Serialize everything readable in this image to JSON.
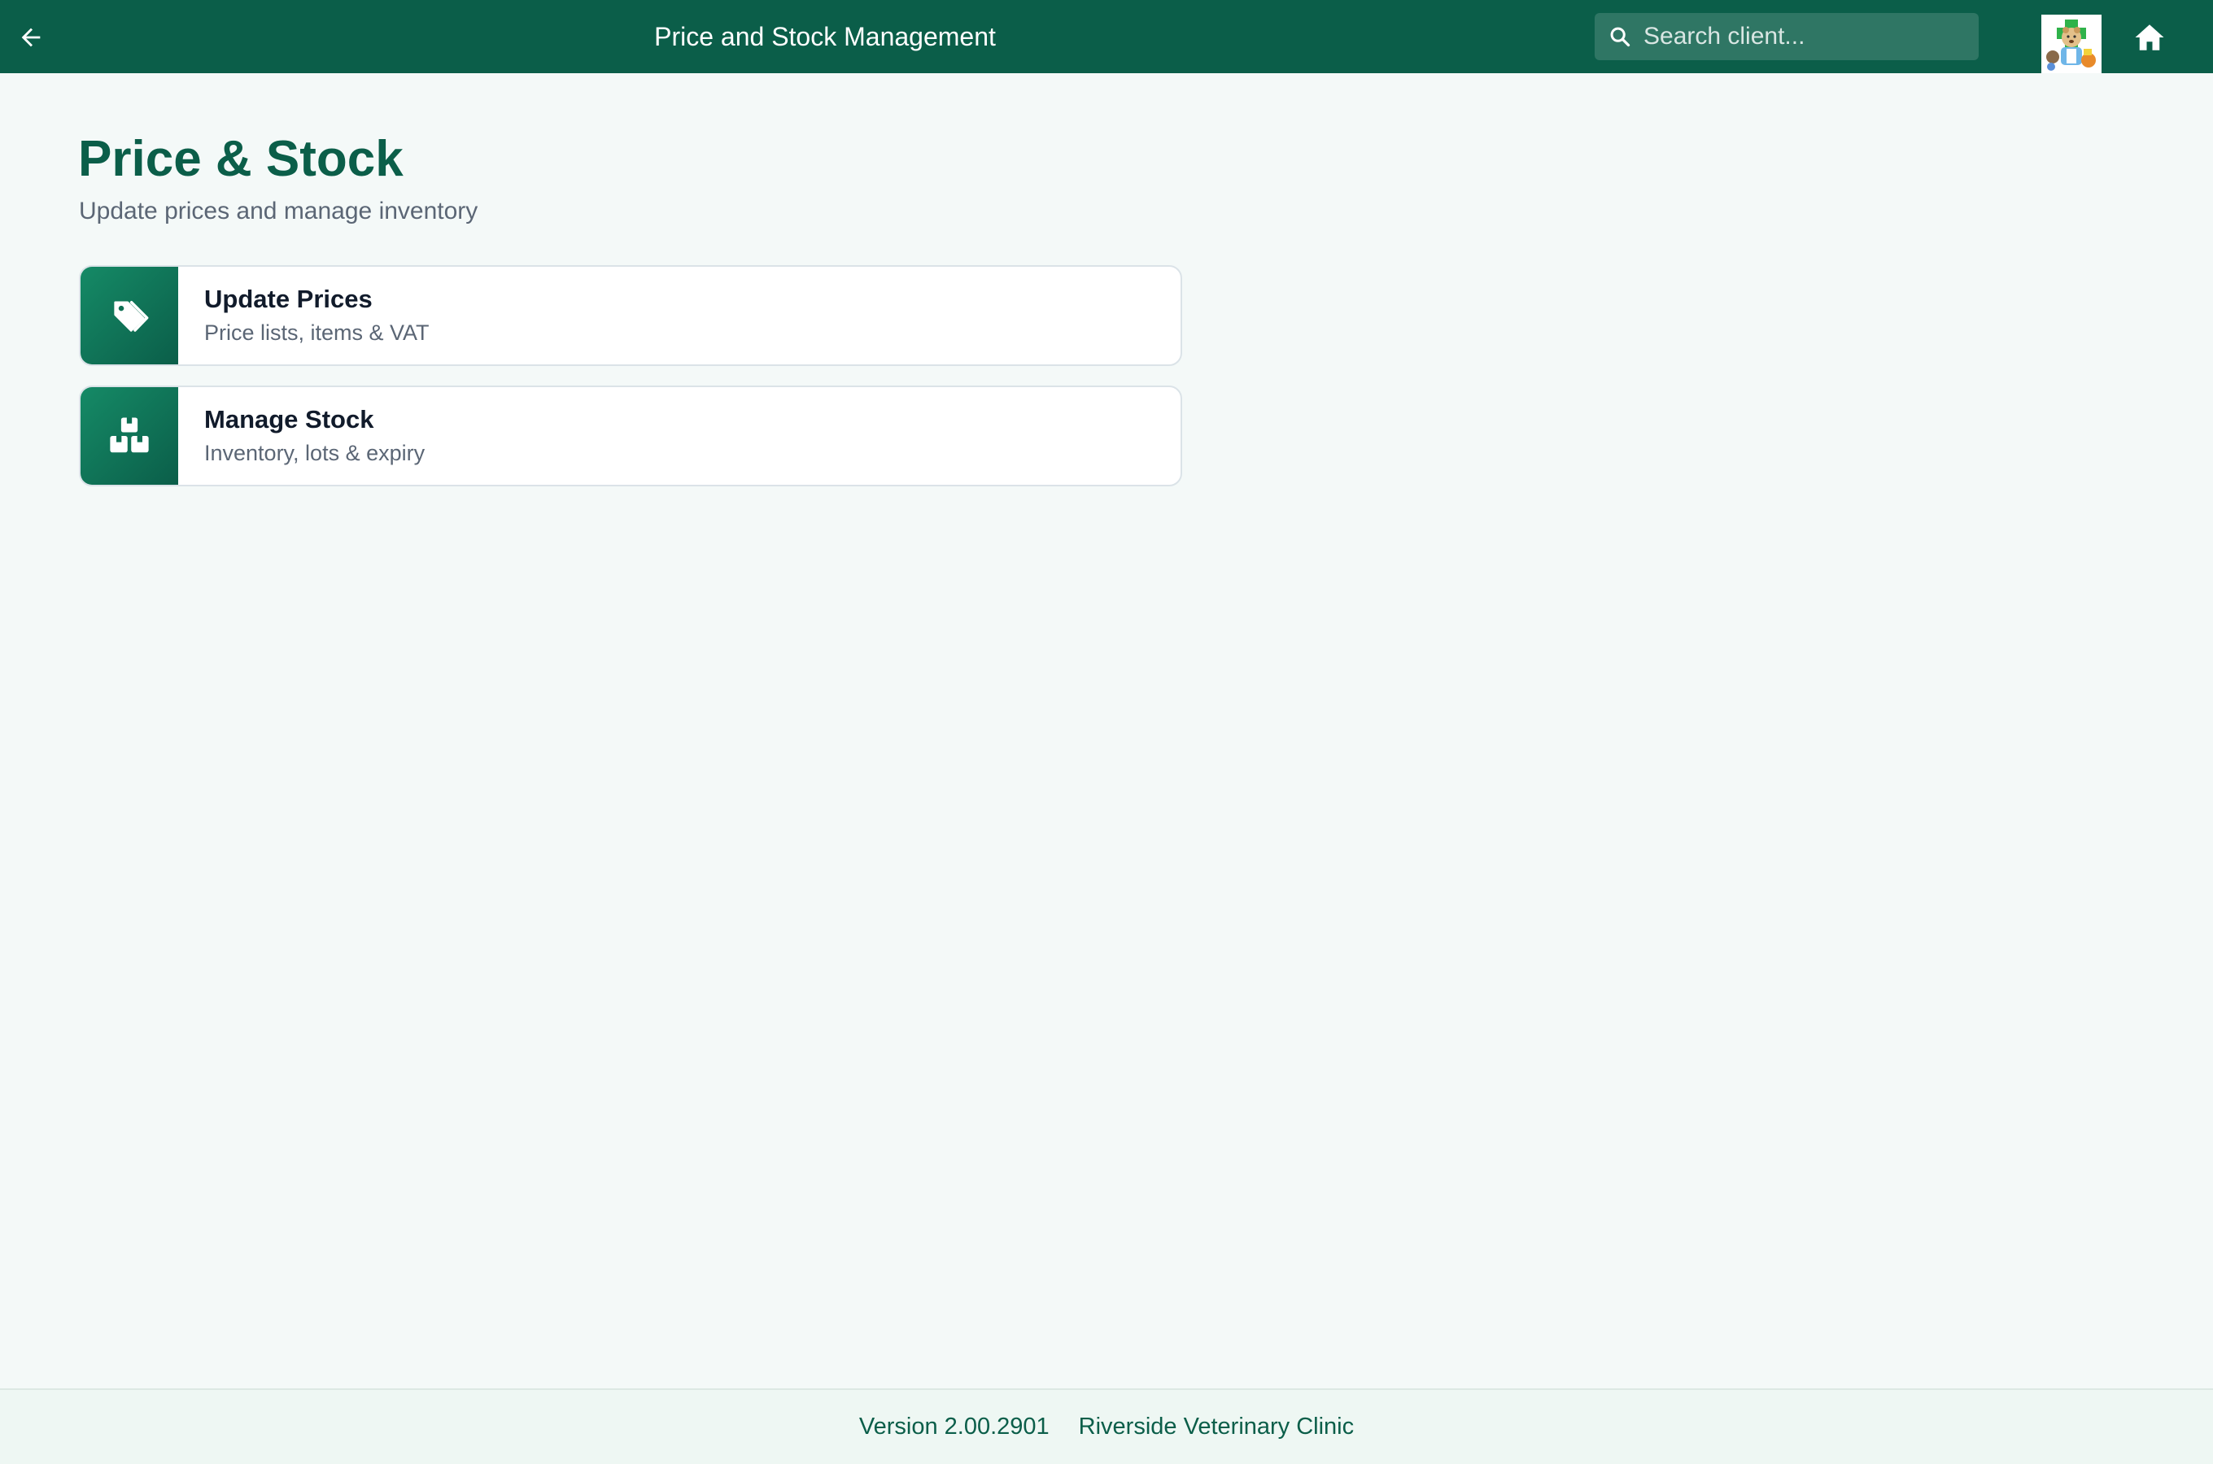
{
  "header": {
    "title": "Price and Stock Management",
    "search_placeholder": "Search client...",
    "back_icon": "arrow-left-icon",
    "home_icon": "home-icon",
    "logo": "clinic-logo"
  },
  "page": {
    "heading": "Price & Stock",
    "subtitle": "Update prices and manage inventory"
  },
  "cards": [
    {
      "title": "Update Prices",
      "subtitle": "Price lists, items & VAT",
      "icon": "price-tags-icon"
    },
    {
      "title": "Manage Stock",
      "subtitle": "Inventory, lots & expiry",
      "icon": "boxes-icon"
    }
  ],
  "footer": {
    "version": "Version 2.00.2901",
    "clinic": "Riverside Veterinary Clinic"
  },
  "colors": {
    "primary": "#0b5e49",
    "background": "#f4f9f8",
    "card_border": "#dbe3e8",
    "footer_bg": "#eef7f3"
  }
}
